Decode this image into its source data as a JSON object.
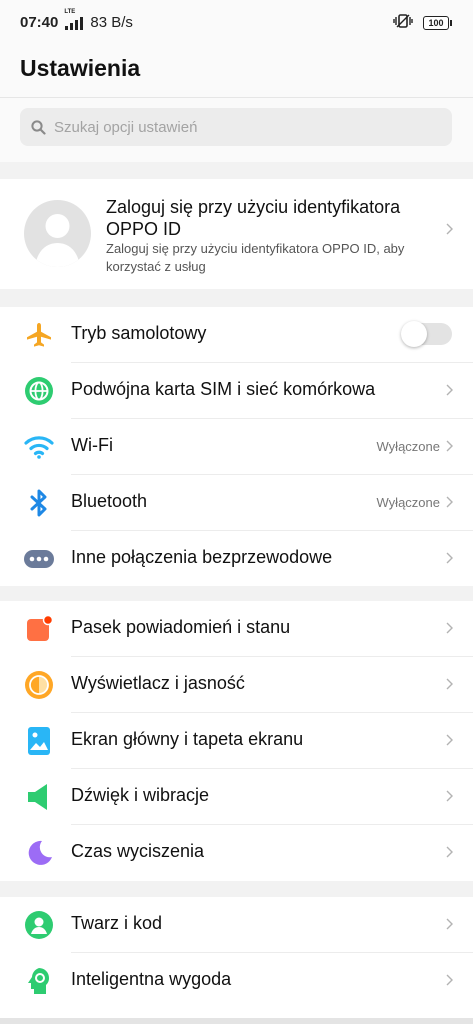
{
  "status_bar": {
    "time": "07:40",
    "network_type": "LTE",
    "net_speed": "83 B/s",
    "battery": "100",
    "icons": [
      "signal-icon",
      "vibrate-icon",
      "battery-icon"
    ]
  },
  "header": {
    "title": "Ustawienia"
  },
  "search": {
    "placeholder": "Szukaj opcji ustawień"
  },
  "account": {
    "title": "Zaloguj się przy użyciu identyfikatora OPPO ID",
    "subtitle": "Zaloguj się przy użyciu identyfikatora OPPO ID, aby korzystać z usług"
  },
  "connectivity": {
    "items": [
      {
        "label": "Tryb samolotowy",
        "icon": "airplane-icon",
        "toggle": false
      },
      {
        "label": "Podwójna karta SIM i sieć komórkowa",
        "icon": "globe-icon"
      },
      {
        "label": "Wi-Fi",
        "icon": "wifi-icon",
        "value": "Wyłączone"
      },
      {
        "label": "Bluetooth",
        "icon": "bluetooth-icon",
        "value": "Wyłączone"
      },
      {
        "label": "Inne połączenia bezprzewodowe",
        "icon": "more-connections-icon"
      }
    ]
  },
  "personalization": {
    "items": [
      {
        "label": "Pasek powiadomień i stanu",
        "icon": "notification-icon"
      },
      {
        "label": "Wyświetlacz i jasność",
        "icon": "display-icon"
      },
      {
        "label": "Ekran główny i tapeta ekranu",
        "icon": "wallpaper-icon"
      },
      {
        "label": "Dźwięk i wibracje",
        "icon": "sound-icon"
      },
      {
        "label": "Czas wyciszenia",
        "icon": "moon-icon"
      }
    ]
  },
  "security": {
    "items": [
      {
        "label": "Twarz i kod",
        "icon": "face-icon"
      },
      {
        "label": "Inteligentna wygoda",
        "icon": "smart-icon"
      }
    ]
  },
  "colors": {
    "airplane": "#f5a623",
    "globe": "#2ecc71",
    "wifi": "#29b6f6",
    "bluetooth": "#1e88e5",
    "notification": "#ff6e40",
    "display": "#ffa726",
    "wallpaper": "#29b6f6",
    "sound": "#2ecc71",
    "moon": "#9c6cf5",
    "face": "#2ecc71"
  }
}
